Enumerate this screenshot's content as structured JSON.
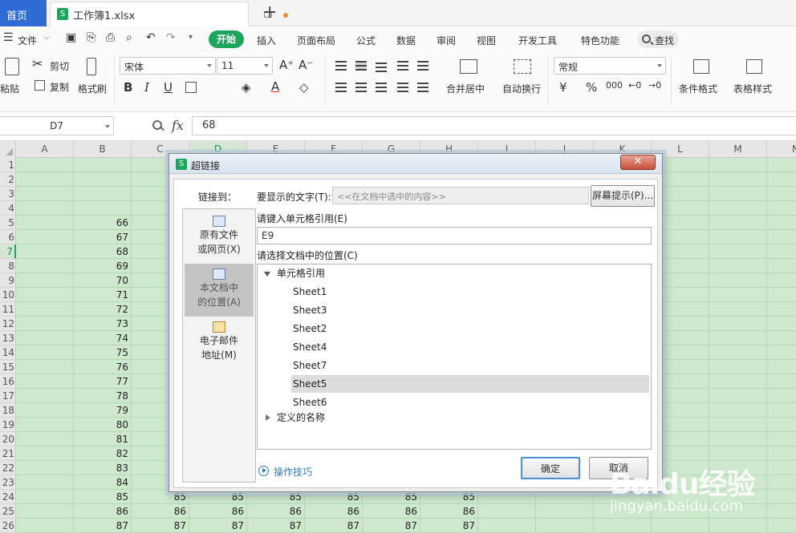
{
  "titlebar": {
    "home_tab": "首页",
    "file_tab": "工作簿1.xlsx"
  },
  "menubar": {
    "file_menu": "文件",
    "items": [
      "开始",
      "插入",
      "页面布局",
      "公式",
      "数据",
      "审阅",
      "视图",
      "开发工具",
      "特色功能"
    ],
    "search_label": "查找"
  },
  "ribbon": {
    "paste": "粘贴",
    "cut": "剪切",
    "copy": "复制",
    "format_painter": "格式刷",
    "font_name": "宋体",
    "font_size": "11",
    "merge_center": "合并居中",
    "wrap_text": "自动换行",
    "number_format": "常规",
    "conditional_format": "条件格式",
    "table_style": "表格样式"
  },
  "formula_bar": {
    "name_box": "D7",
    "fx": "fx",
    "formula": "68"
  },
  "grid": {
    "columns": [
      "A",
      "B",
      "C",
      "D",
      "E",
      "F",
      "G",
      "H",
      "I",
      "J",
      "K",
      "L",
      "M",
      "N"
    ],
    "selected_column": "D",
    "rows": [
      "1",
      "2",
      "3",
      "4",
      "5",
      "6",
      "7",
      "8",
      "9",
      "10",
      "11",
      "12",
      "13",
      "14",
      "15",
      "16",
      "17",
      "18",
      "19",
      "20",
      "21",
      "22",
      "23",
      "24",
      "25",
      "26"
    ],
    "selected_row": "7",
    "column_b_values": [
      "66",
      "67",
      "68",
      "69",
      "70",
      "71",
      "72",
      "73",
      "74",
      "75",
      "76",
      "77",
      "78",
      "79",
      "80",
      "81",
      "82",
      "83",
      "84",
      "85",
      "86",
      "87"
    ],
    "lower_rows": [
      [
        "85",
        "85",
        "85",
        "85",
        "85",
        "85",
        "85"
      ],
      [
        "86",
        "86",
        "86",
        "86",
        "86",
        "86",
        "86"
      ],
      [
        "87",
        "87",
        "87",
        "87",
        "87",
        "87",
        "87"
      ]
    ]
  },
  "dialog": {
    "title": "超链接",
    "link_to_label": "链接到：",
    "display_text_label": "要显示的文字(T):",
    "display_text_value": "<<在文档中选中的内容>>",
    "screentip_button": "屏幕提示(P)...",
    "link_options": [
      {
        "line1": "原有文件",
        "line2": "或网页(X)"
      },
      {
        "line1": "本文档中",
        "line2": "的位置(A)"
      },
      {
        "line1": "电子邮件",
        "line2": "地址(M)"
      }
    ],
    "cell_ref_label": "请键入单元格引用(E)",
    "cell_ref_value": "E9",
    "location_label": "请选择文档中的位置(C)",
    "tree_root": "单元格引用",
    "sheets": [
      "Sheet1",
      "Sheet3",
      "Sheet2",
      "Sheet4",
      "Sheet7",
      "Sheet5",
      "Sheet6"
    ],
    "selected_sheet": "Sheet5",
    "defined_names": "定义的名称",
    "tips_link": "操作技巧",
    "ok": "确定",
    "cancel": "取消"
  },
  "watermark": {
    "brand": "Baidu经验",
    "url": "jingyan.baidu.com"
  },
  "colors": {
    "accent_green": "#1ea55d",
    "home_blue": "#2f6bd4",
    "cell_bg": "#cde8cc",
    "annotation_red": "#e8312b"
  }
}
